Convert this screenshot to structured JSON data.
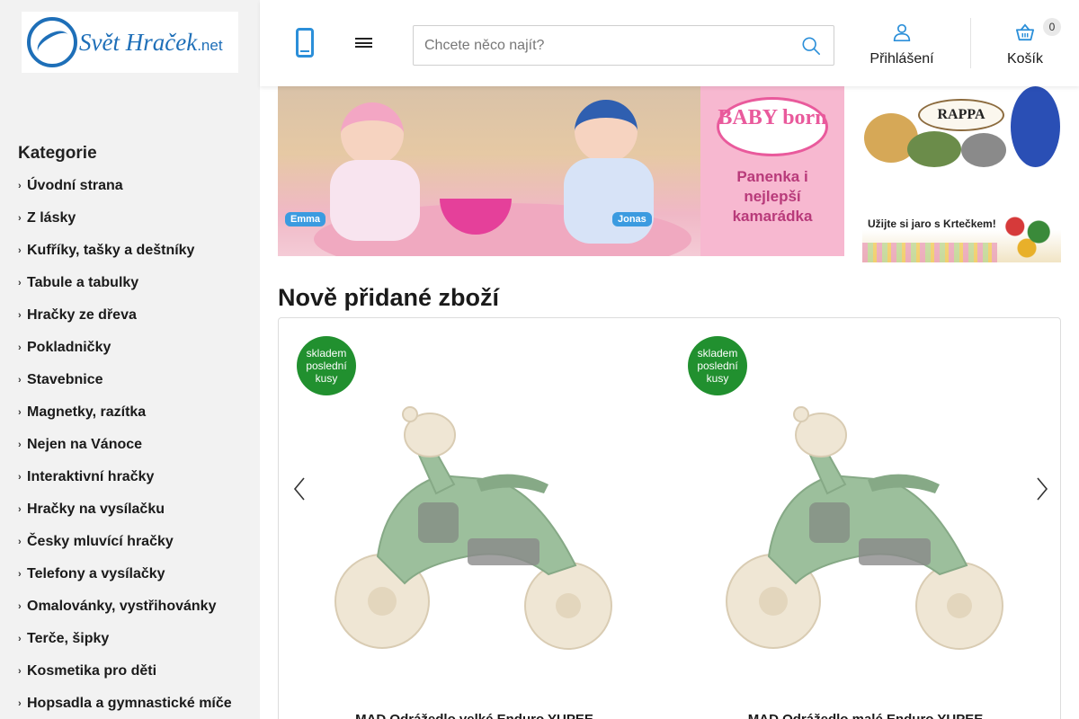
{
  "brand": {
    "logo_main": "Svět Hraček",
    "logo_suffix": ".net"
  },
  "sidebar": {
    "title": "Kategorie",
    "items": [
      "Úvodní strana",
      "Z lásky",
      "Kufříky, tašky a deštníky",
      "Tabule a tabulky",
      "Hračky ze dřeva",
      "Pokladničky",
      "Stavebnice",
      "Magnetky, razítka",
      "Nejen na Vánoce",
      "Interaktivní hračky",
      "Hračky na vysílačku",
      "Česky mluvící hračky",
      "Telefony a vysílačky",
      "Omalovánky, vystřihovánky",
      "Terče, šipky",
      "Kosmetika pro děti",
      "Hopsadla a gymnastické míče"
    ]
  },
  "header": {
    "search_placeholder": "Chcete něco najít?",
    "login_label": "Přihlášení",
    "cart_label": "Košík",
    "cart_count": "0"
  },
  "banners": {
    "main": {
      "doll_left": "Emma",
      "doll_right": "Jonas",
      "brand": "BABY born",
      "tagline": "Panenka i nejlepší kamarádka"
    },
    "rappa": {
      "brand": "RAPPA"
    },
    "krtek": {
      "text": "Užijte si jaro s Krtečkem!"
    }
  },
  "section": {
    "title": "Nově přidané zboží"
  },
  "products": [
    {
      "badge_line1": "skladem",
      "badge_line2": "poslední",
      "badge_line3": "kusy",
      "name": "MAD Odrážedlo velké Enduro YUPEE"
    },
    {
      "badge_line1": "skladem",
      "badge_line2": "poslední",
      "badge_line3": "kusy",
      "name": "MAD Odrážedlo malé Enduro YUPEE"
    }
  ],
  "colors": {
    "accent": "#2b8fd9",
    "badge_green": "#21902f",
    "sidebar_bg": "#f2f2f2",
    "product_green": "#9cbf9c",
    "product_cream": "#efe6d4"
  },
  "icons": {
    "phone": "phone-icon",
    "menu": "menu-icon",
    "search": "search-icon",
    "user": "user-icon",
    "cart": "basket-icon",
    "prev": "chevron-left-icon",
    "next": "chevron-right-icon"
  }
}
